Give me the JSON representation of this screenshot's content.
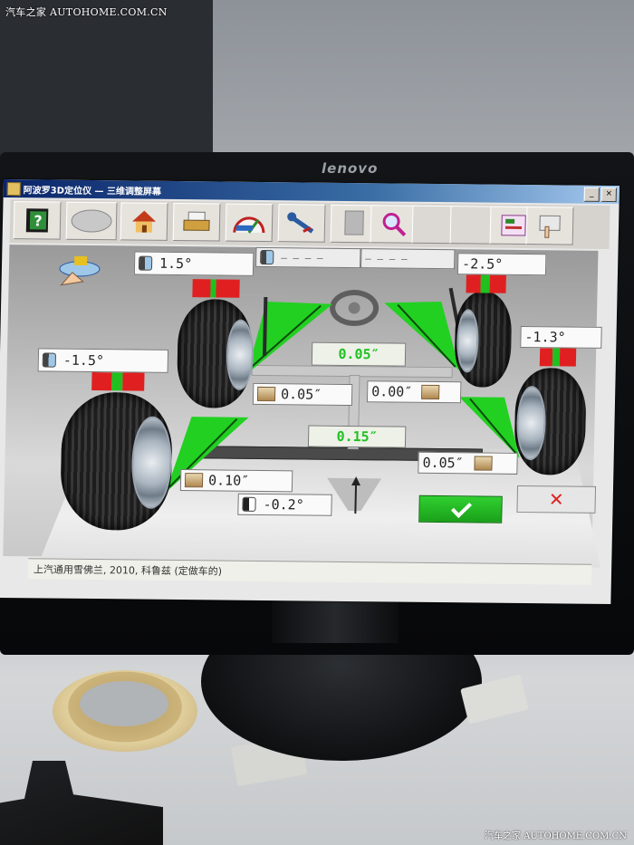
{
  "watermark": {
    "top": "汽车之家 AUTOHOME.COM.CN",
    "bottom": "汽车之家 AUTOHOME.COM.CN"
  },
  "monitor": {
    "brand": "lenovo"
  },
  "window": {
    "title": "阿波罗3D定位仪   —  三维调整屏幕",
    "minimize": "_",
    "close": "×"
  },
  "toolbar": {
    "buttons": [
      {
        "name": "help",
        "icon": "help-book-icon"
      },
      {
        "name": "disc",
        "icon": "disc-icon"
      },
      {
        "name": "home",
        "icon": "home-icon"
      },
      {
        "name": "printer",
        "icon": "printer-icon"
      },
      {
        "name": "gauge",
        "icon": "gauge-icon"
      },
      {
        "name": "wrench",
        "icon": "wrench-icon"
      },
      {
        "name": "blank-sheet",
        "icon": "sheet-icon"
      },
      {
        "name": "zoom",
        "icon": "magnifier-icon"
      },
      {
        "name": "empty-1",
        "icon": ""
      },
      {
        "name": "empty-2",
        "icon": ""
      },
      {
        "name": "report",
        "icon": "report-icon"
      },
      {
        "name": "settings-hand",
        "icon": "hand-pointer-icon"
      }
    ]
  },
  "readings": {
    "front_left_camber": "1.5°",
    "front_right_camber": "-2.5°",
    "rear_left_camber": "-1.5°",
    "rear_right_camber": "-1.3°",
    "front_total_toe": "0.05″",
    "front_left_toe": "0.05″",
    "front_right_toe": "0.00″",
    "rear_total_toe": "0.15″",
    "rear_left_toe": "0.10″",
    "rear_right_toe": "0.05″",
    "thrust_angle": "-0.2°",
    "front_top_left_dim": "— — — —",
    "front_top_right_dim": "— — — —"
  },
  "colors": {
    "in_spec": "#22c022",
    "out_of_spec": "#e02020",
    "title_bar": "#0a246a"
  },
  "actions": {
    "ok_icon": "check-icon",
    "cancel_icon": "cross-icon",
    "cancel_label": "✕"
  },
  "status": {
    "vehicle": "上汽通用雪佛兰, 2010, 科鲁兹 (定做车的)"
  }
}
